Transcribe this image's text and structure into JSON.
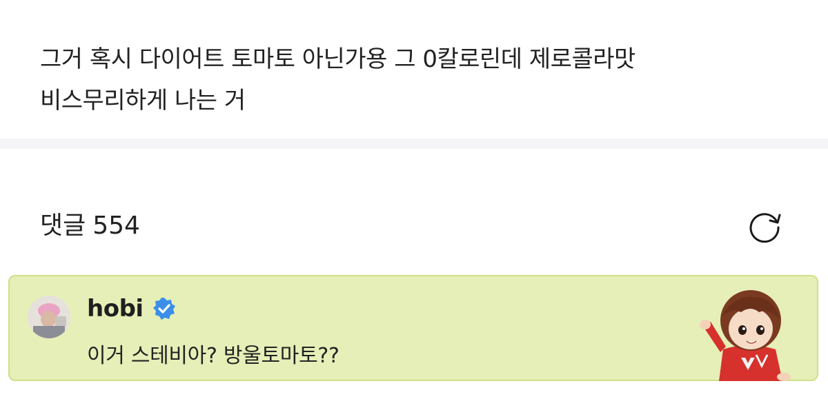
{
  "post": {
    "body_line_1": "그거 혹시 다이어트 토마토 아닌가용 그 0칼로린데 제로콜라맛",
    "body_line_2": "비스무리하게 나는 거"
  },
  "comments": {
    "title": "댓글",
    "count": "554",
    "refresh_icon": "refresh-icon",
    "items": [
      {
        "author": "hobi",
        "verified": true,
        "verified_icon": "verified-badge-icon",
        "text": "이거 스테비아? 방울토마토??",
        "avatar": "profile-photo",
        "sticker": "character-sticker"
      }
    ]
  },
  "colors": {
    "highlight_bg": "#e5efb7",
    "highlight_border": "#cfe08a",
    "verified_blue": "#3b8fe8",
    "divider": "#f5f5f8"
  }
}
